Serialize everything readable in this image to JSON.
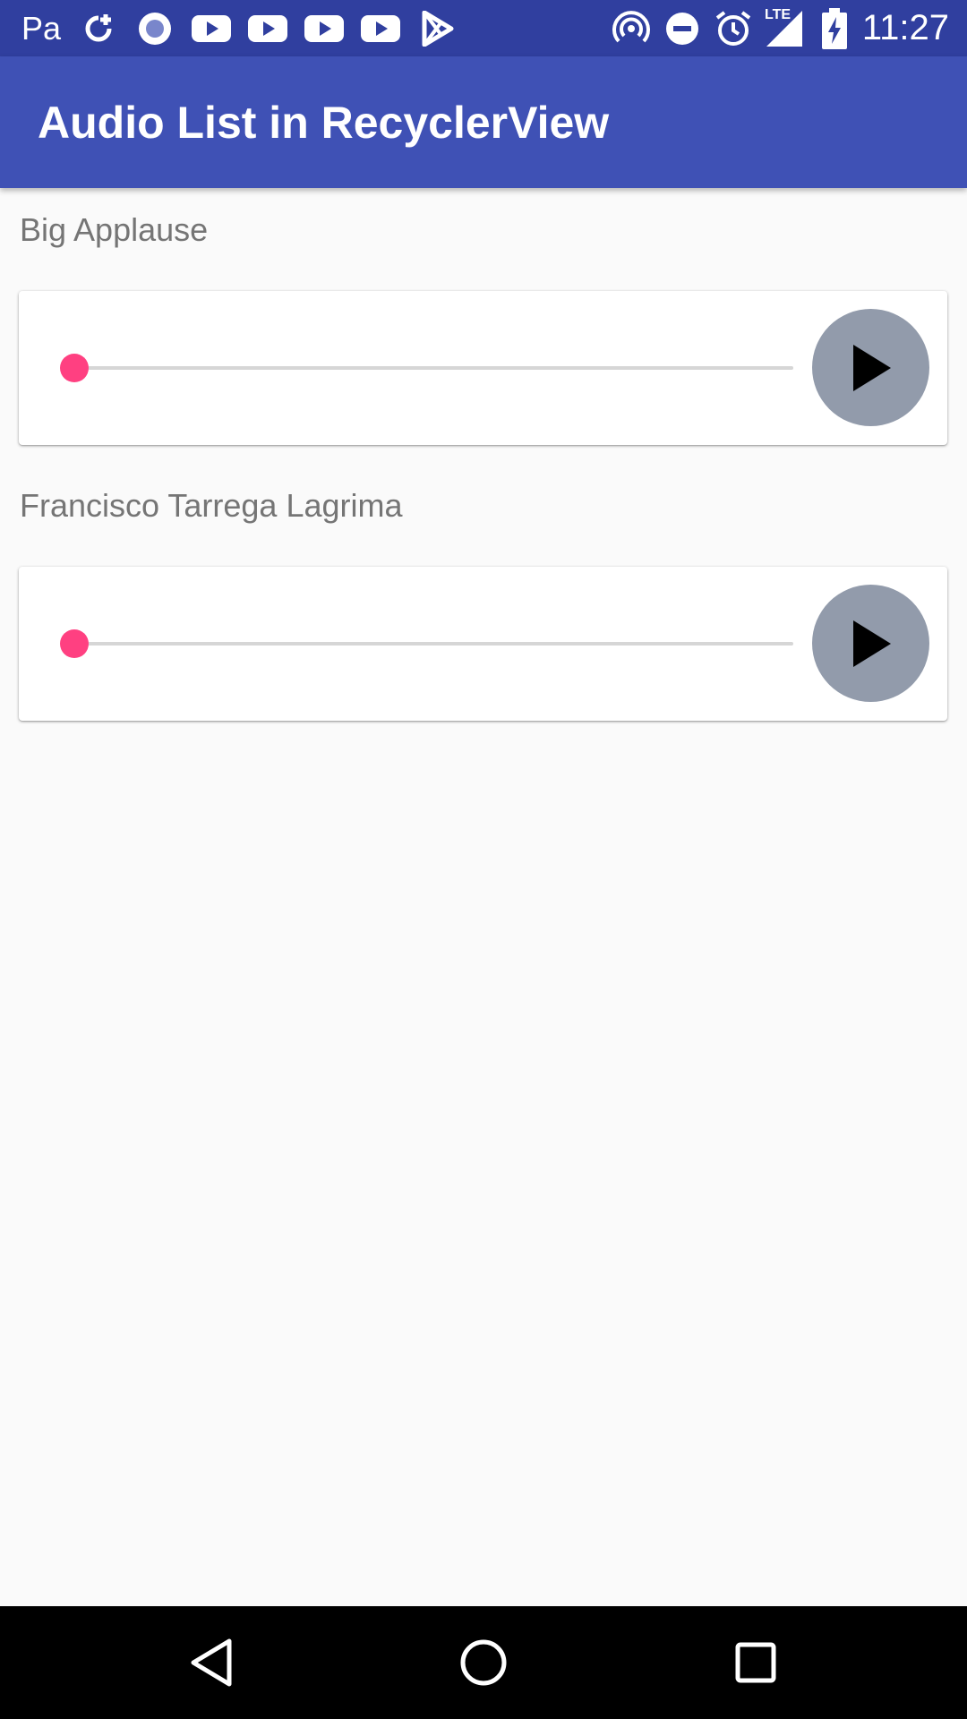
{
  "status_bar": {
    "carrier": "Pa",
    "time": "11:27",
    "network_label": "LTE",
    "left_icons": [
      "sync-plus-icon",
      "record-icon",
      "youtube-icon",
      "youtube-icon",
      "youtube-icon",
      "youtube-icon",
      "play-store-icon"
    ],
    "right_icons": [
      "hotspot-icon",
      "do-not-disturb-icon",
      "alarm-icon",
      "signal-icon",
      "battery-charging-icon"
    ]
  },
  "app_bar": {
    "title": "Audio List in RecyclerView",
    "color": "#3f51b5"
  },
  "audio_items": [
    {
      "title": "Big Applause",
      "progress": 0,
      "play_icon": "play-icon"
    },
    {
      "title": "Francisco Tarrega Lagrima",
      "progress": 0,
      "play_icon": "play-icon"
    }
  ],
  "colors": {
    "accent": "#ff4081",
    "status_bar": "#303f9f",
    "play_button": "#929bab"
  },
  "nav_bar": {
    "icons": [
      "back-icon",
      "home-icon",
      "recents-icon"
    ]
  }
}
